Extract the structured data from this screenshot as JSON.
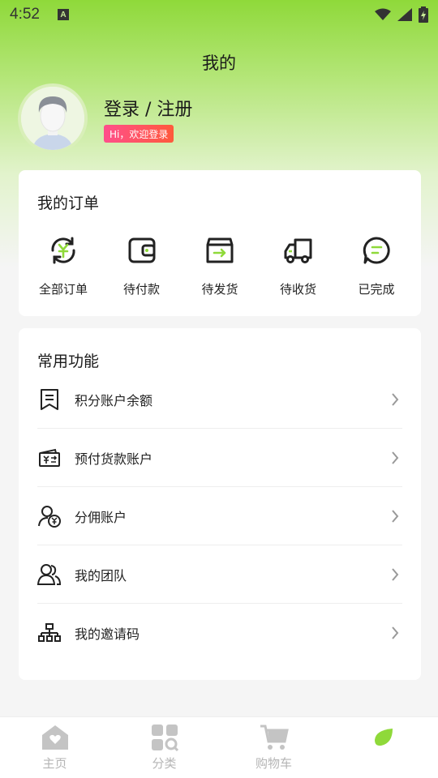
{
  "status_bar": {
    "time": "4:52",
    "notification_letter": "A"
  },
  "header": {
    "title": "我的"
  },
  "profile": {
    "login_text": "登录 / 注册",
    "greeting": "Hi，欢迎登录"
  },
  "orders": {
    "title": "我的订单",
    "items": [
      {
        "label": "全部订单",
        "icon": "yuan-refresh-icon"
      },
      {
        "label": "待付款",
        "icon": "wallet-icon"
      },
      {
        "label": "待发货",
        "icon": "box-icon"
      },
      {
        "label": "待收货",
        "icon": "truck-icon"
      },
      {
        "label": "已完成",
        "icon": "chat-bubble-icon"
      }
    ]
  },
  "functions": {
    "title": "常用功能",
    "items": [
      {
        "label": "积分账户余额",
        "icon": "receipt-icon"
      },
      {
        "label": "预付货款账户",
        "icon": "card-transfer-icon"
      },
      {
        "label": "分佣账户",
        "icon": "user-yuan-icon"
      },
      {
        "label": "我的团队",
        "icon": "team-icon"
      },
      {
        "label": "我的邀请码",
        "icon": "org-chart-icon"
      }
    ]
  },
  "tabbar": {
    "items": [
      {
        "label": "主页",
        "icon": "home-icon"
      },
      {
        "label": "分类",
        "icon": "category-icon"
      },
      {
        "label": "购物车",
        "icon": "cart-icon"
      },
      {
        "label": "",
        "icon": "leaf-icon"
      }
    ]
  },
  "colors": {
    "accent": "#8fd93a",
    "badge_start": "#ff4f8b",
    "badge_end": "#ff5a3c",
    "icon_dark": "#222222"
  }
}
